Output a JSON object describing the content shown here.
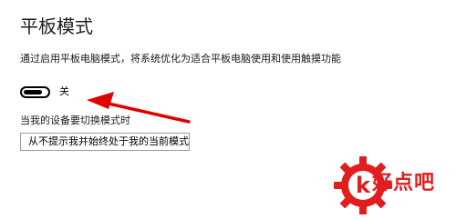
{
  "settings": {
    "title": "平板模式",
    "description": "通过启用平板电脑模式，将系统优化为适合平板电脑使用和使用触摸功能",
    "toggle": {
      "state_label": "关",
      "on": false
    },
    "mode_label": "当我的设备要切换模式时",
    "mode_select": {
      "selected": "从不提示我并始终处于我的当前模式"
    }
  },
  "annotation": {
    "arrow_color": "#e00000"
  },
  "watermark": {
    "text": "好点吧",
    "logo_glyph": "k",
    "color": "#e11d1d"
  }
}
